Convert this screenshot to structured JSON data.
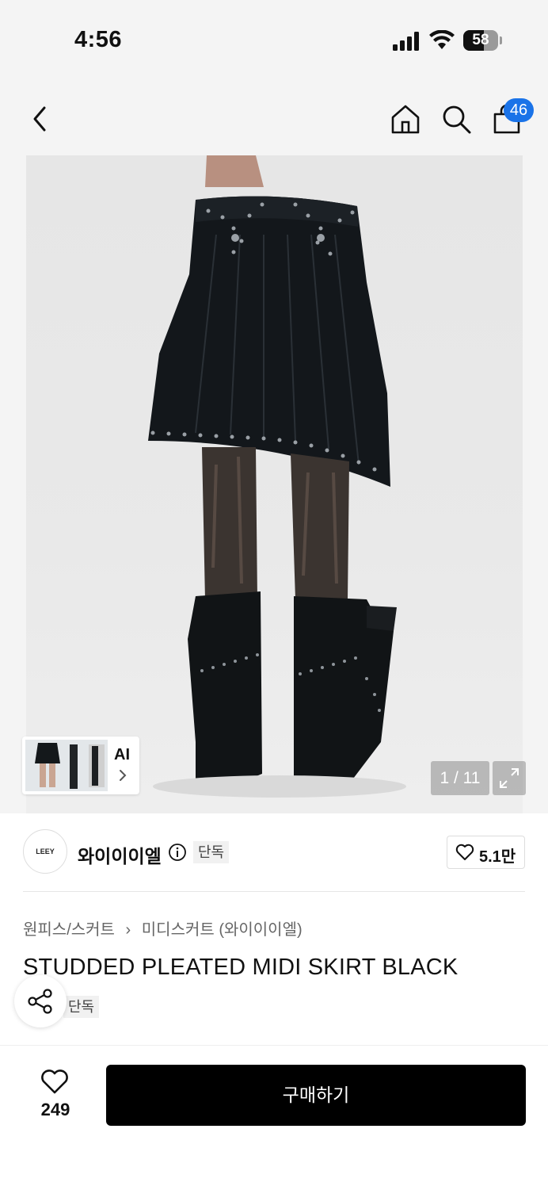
{
  "status_bar": {
    "time": "4:56",
    "battery": "58"
  },
  "header": {
    "back_icon": "chevron-left-icon",
    "home_icon": "home-icon",
    "search_icon": "search-icon",
    "bag_icon": "shopping-bag-icon",
    "bag_badge_count": "46",
    "badge_color": "#1a73e8"
  },
  "gallery": {
    "ai_label": "AI",
    "page_indicator": "1 / 11",
    "expand_icon": "expand-icon"
  },
  "brand": {
    "logo_text": "LEEY",
    "name": "와이이이엘",
    "exclusive_badge": "단독",
    "like_count": "5.1만"
  },
  "breadcrumb": {
    "category": "원피스/스커트",
    "subcategory": "미디스커트 (와이이이엘)"
  },
  "product": {
    "title": "STUDDED PLEATED MIDI SKIRT BLACK",
    "tag": "단독"
  },
  "bottom_bar": {
    "wish_count": "249",
    "buy_label": "구매하기"
  }
}
